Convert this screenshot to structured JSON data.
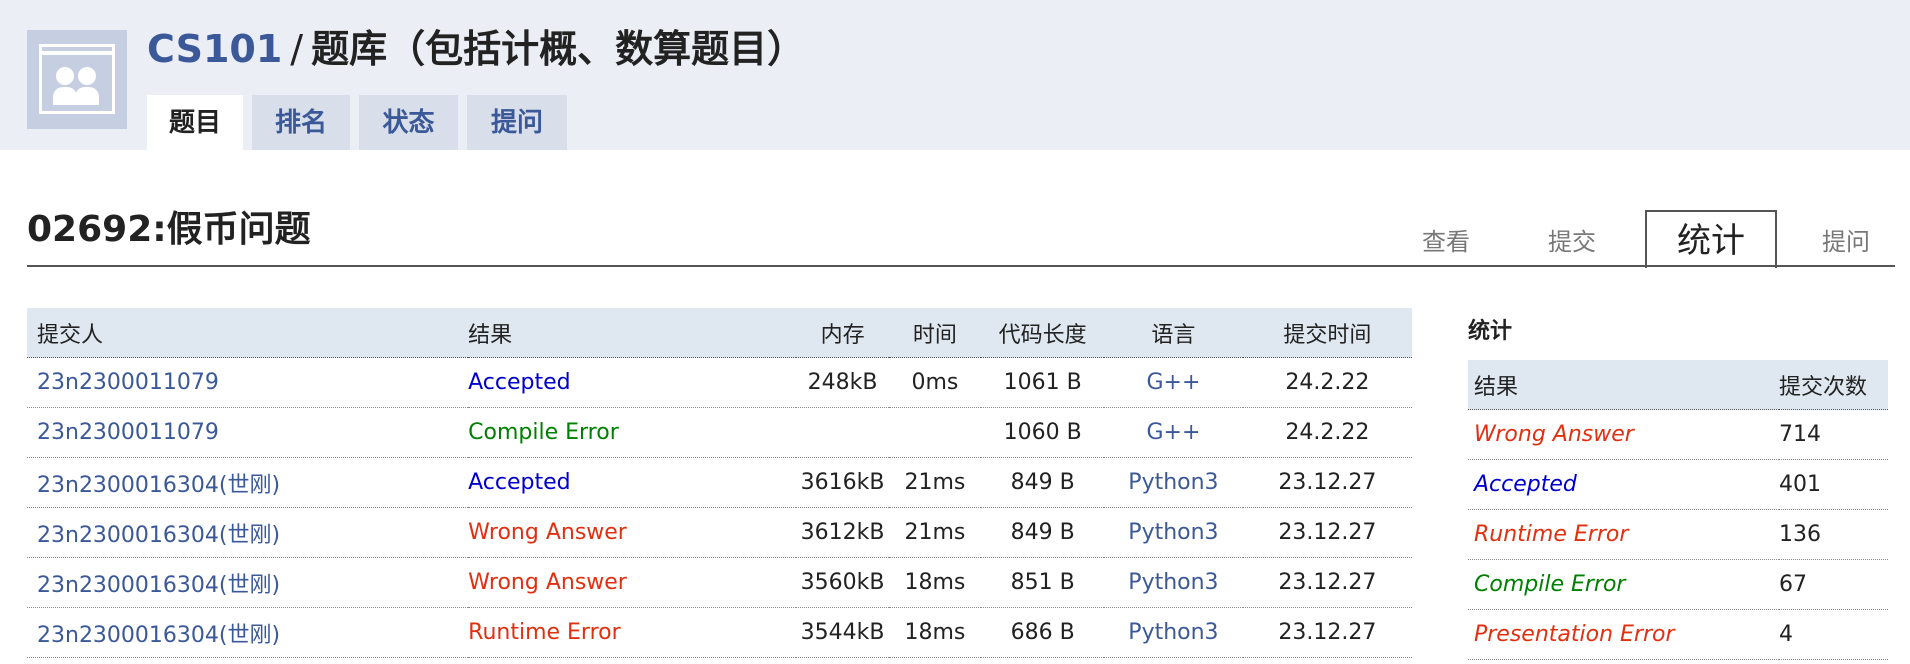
{
  "header": {
    "course": "CS101",
    "separator": "/",
    "bank_title": "题库（包括计概、数算题目）",
    "tabs": [
      "题目",
      "排名",
      "状态",
      "提问"
    ]
  },
  "problem": {
    "title": "02692:假币问题",
    "tabs": [
      "查看",
      "提交",
      "统计",
      "提问"
    ]
  },
  "submissions": {
    "headers": [
      "提交人",
      "结果",
      "内存",
      "时间",
      "代码长度",
      "语言",
      "提交时间"
    ],
    "rows": [
      {
        "user": "23n2300011079",
        "result": "Accepted",
        "result_color": "#0000cc",
        "memory": "248kB",
        "time": "0ms",
        "length": "1061 B",
        "lang": "G++",
        "date": "24.2.22"
      },
      {
        "user": "23n2300011079",
        "result": "Compile Error",
        "result_color": "#008000",
        "memory": "",
        "time": "",
        "length": "1060 B",
        "lang": "G++",
        "date": "24.2.22"
      },
      {
        "user": "23n2300016304(世刚)",
        "result": "Accepted",
        "result_color": "#0000cc",
        "memory": "3616kB",
        "time": "21ms",
        "length": "849 B",
        "lang": "Python3",
        "date": "23.12.27"
      },
      {
        "user": "23n2300016304(世刚)",
        "result": "Wrong Answer",
        "result_color": "#e03010",
        "memory": "3612kB",
        "time": "21ms",
        "length": "849 B",
        "lang": "Python3",
        "date": "23.12.27"
      },
      {
        "user": "23n2300016304(世刚)",
        "result": "Wrong Answer",
        "result_color": "#e03010",
        "memory": "3560kB",
        "time": "18ms",
        "length": "851 B",
        "lang": "Python3",
        "date": "23.12.27"
      },
      {
        "user": "23n2300016304(世刚)",
        "result": "Runtime Error",
        "result_color": "#e03010",
        "memory": "3544kB",
        "time": "18ms",
        "length": "686 B",
        "lang": "Python3",
        "date": "23.12.27"
      }
    ]
  },
  "stats": {
    "title": "统计",
    "headers": [
      "结果",
      "提交次数"
    ],
    "rows": [
      {
        "result": "Wrong Answer",
        "color": "#e03010",
        "count": "714"
      },
      {
        "result": "Accepted",
        "color": "#0000cc",
        "count": "401"
      },
      {
        "result": "Runtime Error",
        "color": "#e03010",
        "count": "136"
      },
      {
        "result": "Compile Error",
        "color": "#008000",
        "count": "67"
      },
      {
        "result": "Presentation Error",
        "color": "#e03010",
        "count": "4"
      }
    ]
  }
}
